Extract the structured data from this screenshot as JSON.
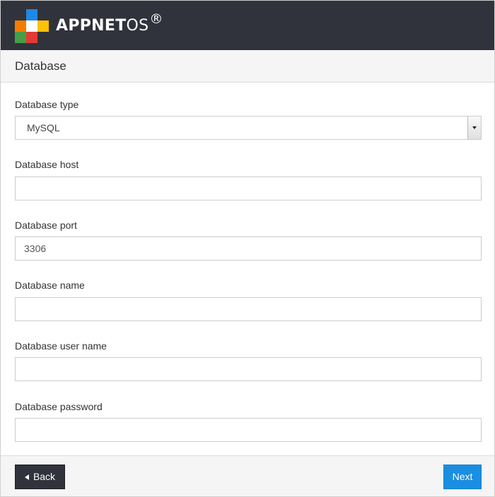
{
  "header": {
    "brand_bold": "APPNET",
    "brand_light": "OS",
    "brand_mark": "®",
    "colors": {
      "bar": "#30333b",
      "accent": "#1a8ee1"
    }
  },
  "section": {
    "title": "Database"
  },
  "form": {
    "db_type": {
      "label": "Database type",
      "value": "MySQL"
    },
    "db_host": {
      "label": "Database host",
      "value": ""
    },
    "db_port": {
      "label": "Database port",
      "value": "3306"
    },
    "db_name": {
      "label": "Database name",
      "value": ""
    },
    "db_user": {
      "label": "Database user name",
      "value": ""
    },
    "db_password": {
      "label": "Database password",
      "value": ""
    }
  },
  "footer": {
    "back_label": "Back",
    "next_label": "Next"
  }
}
